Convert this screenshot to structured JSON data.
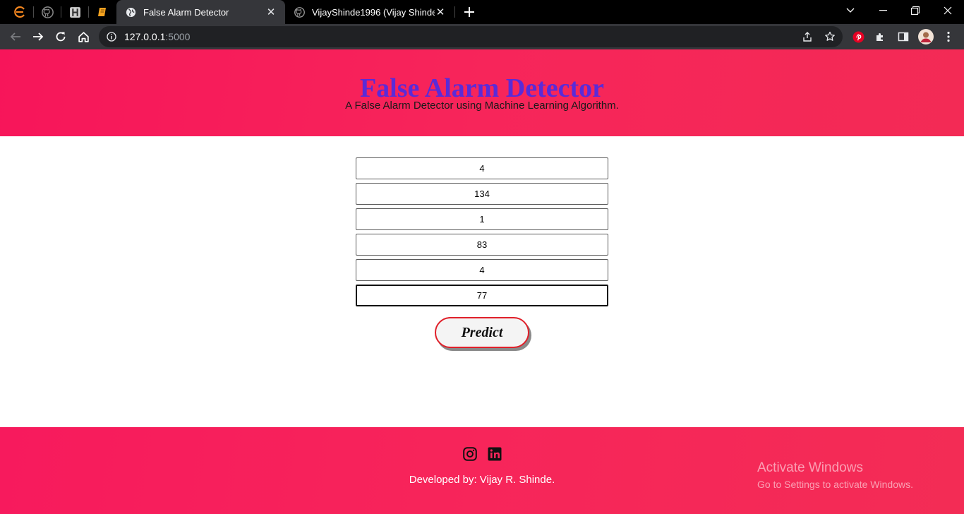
{
  "browser": {
    "pinned_tabs": [
      "liferay-icon",
      "github-icon",
      "hashnode-icon",
      "notebook-icon"
    ],
    "tabs": [
      {
        "title": "False Alarm Detector",
        "icon": "globe-icon",
        "active": true
      },
      {
        "title": "VijayShinde1996 (Vijay Shinde)",
        "icon": "github-icon",
        "active": false
      }
    ],
    "url_host": "127.0.0.1",
    "url_port": ":5000"
  },
  "header": {
    "title": "False Alarm Detector",
    "subtitle": "A False Alarm Detector using Machine Learning Algorithm."
  },
  "form": {
    "fields": [
      "4",
      "134",
      "1",
      "83",
      "4",
      "77"
    ],
    "submit_label": "Predict"
  },
  "footer": {
    "social": [
      "instagram-icon",
      "linkedin-icon"
    ],
    "credit": "Developed by: Vijay R. Shinde."
  },
  "watermark": {
    "title": "Activate Windows",
    "subtitle": "Go to Settings to activate Windows."
  },
  "colors": {
    "header_bg": "#f7155a",
    "title_color": "#5a2bd8",
    "button_border": "#e0202a"
  }
}
